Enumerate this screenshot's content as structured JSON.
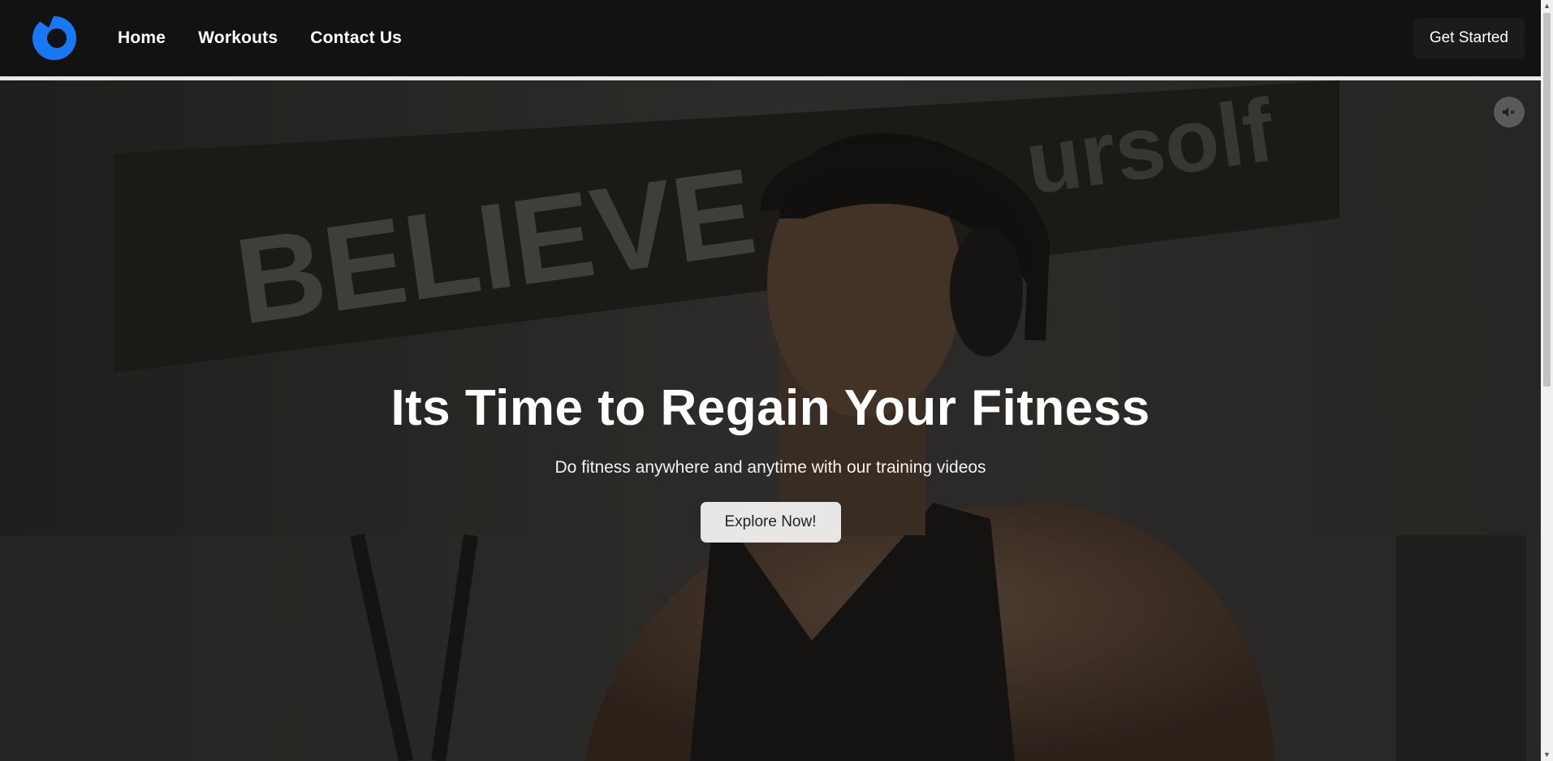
{
  "nav": {
    "links": [
      {
        "label": "Home"
      },
      {
        "label": "Workouts"
      },
      {
        "label": "Contact Us"
      }
    ],
    "cta_label": "Get Started",
    "logo_icon": "logo-icon",
    "brand_color": "#1877f2"
  },
  "hero": {
    "title": "Its Time to Regain Your Fitness",
    "subtitle": "Do fitness anywhere and anytime with our training videos",
    "button_label": "Explore Now!",
    "mute_icon": "mute-icon",
    "background_text": "BELIEVE yourself"
  }
}
